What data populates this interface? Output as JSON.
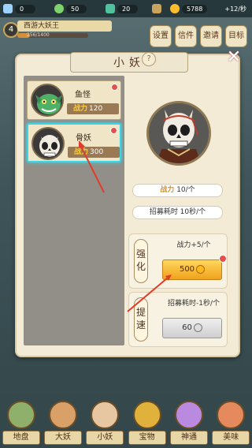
{
  "topbar": {
    "res1": "0",
    "res2": "50",
    "res3": "20",
    "res4": "5788",
    "res5": "+12/秒"
  },
  "header": {
    "level": "4",
    "name": "西游大妖王",
    "exp_text": "256/1400",
    "exp_ratio": 0.18,
    "buttons": [
      "设置",
      "信件",
      "邀请",
      "目标"
    ]
  },
  "panel": {
    "title": "小妖",
    "help": "?",
    "close": "✕"
  },
  "list": {
    "items": [
      {
        "name": "鱼怪",
        "power_label": "战力",
        "power": "120",
        "selected": false
      },
      {
        "name": "骨妖",
        "power_label": "战力",
        "power": "300",
        "selected": true
      }
    ]
  },
  "detail": {
    "power_label": "战力",
    "power_value": "10/个",
    "recruit_time": "招募耗时 10秒/个"
  },
  "strengthen": {
    "label": "强化",
    "desc": "战力+5/个",
    "cost": "500"
  },
  "speedup": {
    "label": "提速",
    "desc": "招募耗时-1秒/个",
    "cost": "60"
  },
  "nav": {
    "items": [
      "地盘",
      "大妖",
      "小妖",
      "宝物",
      "神通",
      "美味"
    ]
  },
  "colors": {
    "selected_border": "#3ad6e8",
    "gold_button": "#f0a21d",
    "red_dot": "#e2514c"
  }
}
